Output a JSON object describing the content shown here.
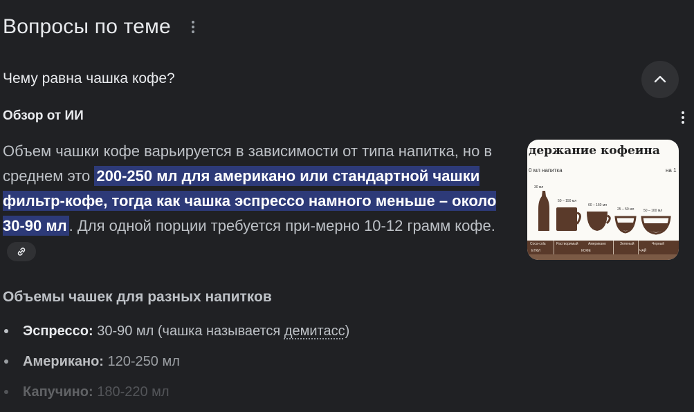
{
  "section": {
    "title": "Вопросы по теме",
    "menu_icon": "more-vert-icon"
  },
  "question": {
    "text": "Чему равна чашка кофе?",
    "toggle_icon": "chevron-up-icon"
  },
  "ai_overview": {
    "label": "Обзор от ИИ",
    "menu_icon": "more-vert-icon",
    "answer_pre": "Объем чашки кофе варьируется в зависимости от типа напитка, но в среднем это ",
    "answer_highlight": "200-250 мл для американо или стандартной чашки фильтр-кофе, тогда как чашка эспрессо намного меньше – около 30-90 мл",
    "answer_post": ". Для одной порции требуется при-мерно 10-12 грамм кофе.",
    "citation_icon": "link-icon",
    "highlight_color": "#2d3a78"
  },
  "thumbnail": {
    "title": "держание кофеина",
    "sub_left": "0 мл напитка",
    "sub_right": "на 1",
    "volumes": [
      "30 мл",
      "50 – 150 мл",
      "60 – 160 мл",
      "25 – 50 мл",
      "50 – 100 мл"
    ],
    "shelf_labels": [
      "Coca-cola",
      "Растворимый",
      "Американо",
      "Зеленый",
      "Черный"
    ],
    "group_labels": [
      "КОФЕ",
      "ЧАЙ"
    ],
    "corner_label": "ЕТКИ"
  },
  "volumes_section": {
    "heading": "Объемы чашек для разных напитков",
    "items": [
      {
        "name": "Эспрессо:",
        "value": "30-90 мл (чашка называется ",
        "link": "демитасс",
        "tail": ")"
      },
      {
        "name": "Американо:",
        "value": "120-250 мл"
      },
      {
        "name": "Капучино:",
        "value": "180-220 мл"
      }
    ]
  },
  "colors": {
    "background": "#202124",
    "button_bg": "#303134",
    "text": "#e8eaed",
    "muted_text": "#bdc1c6"
  }
}
